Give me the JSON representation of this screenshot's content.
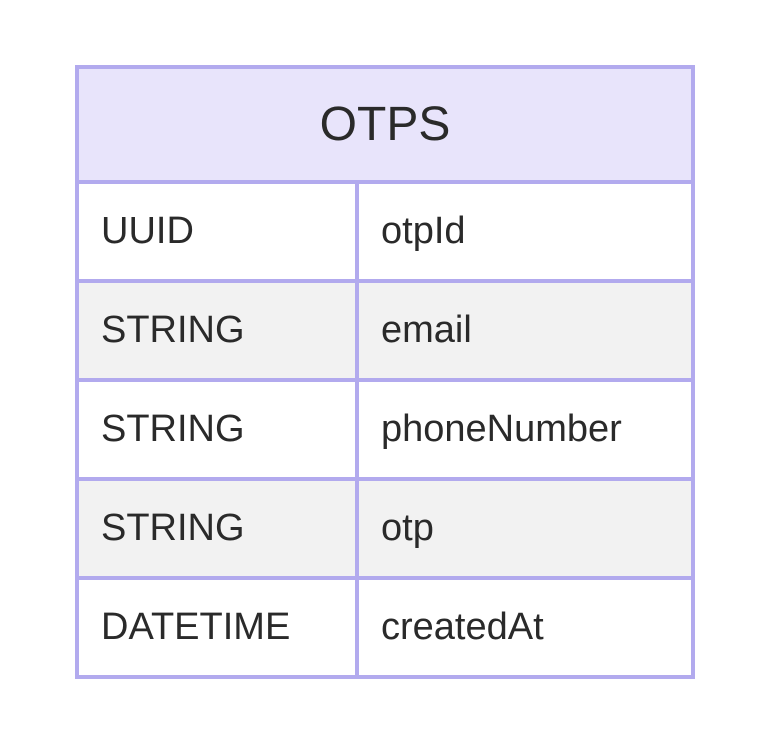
{
  "entity": {
    "title": "OTPS",
    "columns": [
      {
        "type": "UUID",
        "name": "otpId"
      },
      {
        "type": "STRING",
        "name": "email"
      },
      {
        "type": "STRING",
        "name": "phoneNumber"
      },
      {
        "type": "STRING",
        "name": "otp"
      },
      {
        "type": "DATETIME",
        "name": "createdAt"
      }
    ]
  }
}
